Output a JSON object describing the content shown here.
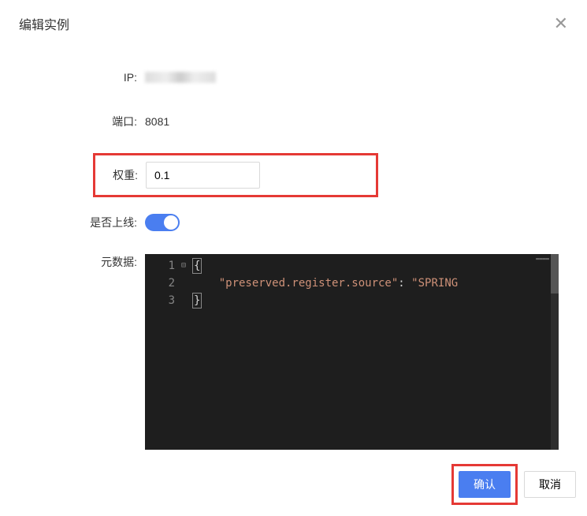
{
  "dialog": {
    "title": "编辑实例"
  },
  "fields": {
    "ip": {
      "label": "IP:"
    },
    "port": {
      "label": "端口:",
      "value": "8081"
    },
    "weight": {
      "label": "权重:",
      "value": "0.1"
    },
    "online": {
      "label": "是否上线:",
      "on": true
    },
    "metadata": {
      "label": "元数据:"
    }
  },
  "editor": {
    "lines": [
      "1",
      "2",
      "3"
    ],
    "fold": "⊟",
    "brace_open": "{",
    "brace_close": "}",
    "key": "\"preserved.register.source\"",
    "colon": ":",
    "value": "\"SPRING",
    "indent": "    "
  },
  "buttons": {
    "confirm": "确认",
    "cancel": "取消"
  }
}
